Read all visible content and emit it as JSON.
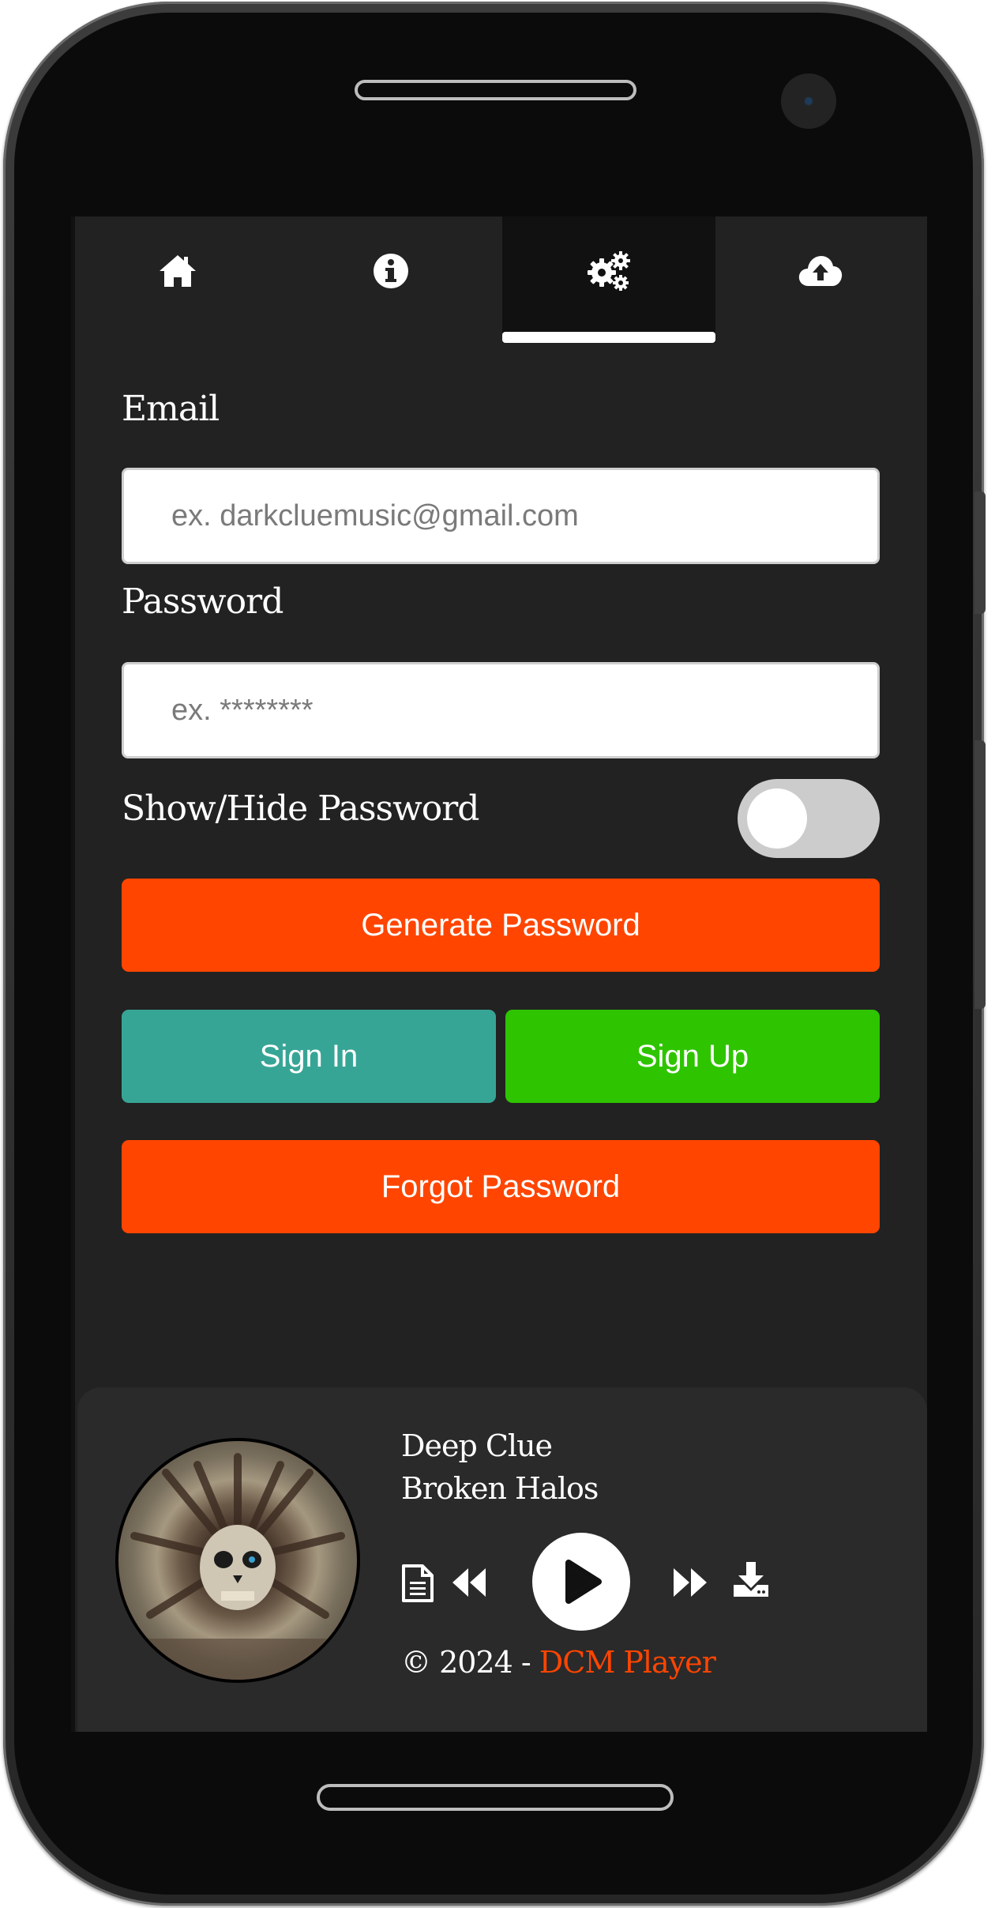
{
  "nav": {
    "tabs": [
      {
        "icon": "home-icon",
        "active": false
      },
      {
        "icon": "info-icon",
        "active": false
      },
      {
        "icon": "gears-icon",
        "active": true
      },
      {
        "icon": "cloud-upload-icon",
        "active": false
      }
    ]
  },
  "form": {
    "email_label": "Email",
    "email_placeholder": "ex. darkcluemusic@gmail.com",
    "password_label": "Password",
    "password_placeholder": "ex. ********",
    "toggle_label": "Show/Hide Password",
    "toggle_on": false,
    "generate_label": "Generate Password",
    "signin_label": "Sign In",
    "signup_label": "Sign Up",
    "forgot_label": "Forgot Password"
  },
  "player": {
    "artist": "Deep Clue",
    "title": "Broken Halos",
    "copyright": "© 2024 - ",
    "brand": "DCM Player"
  },
  "colors": {
    "background": "#222222",
    "accent_orange": "#ff4500",
    "sign_in": "#37a596",
    "sign_up": "#2ec400",
    "toggle_off": "#cccccc"
  }
}
